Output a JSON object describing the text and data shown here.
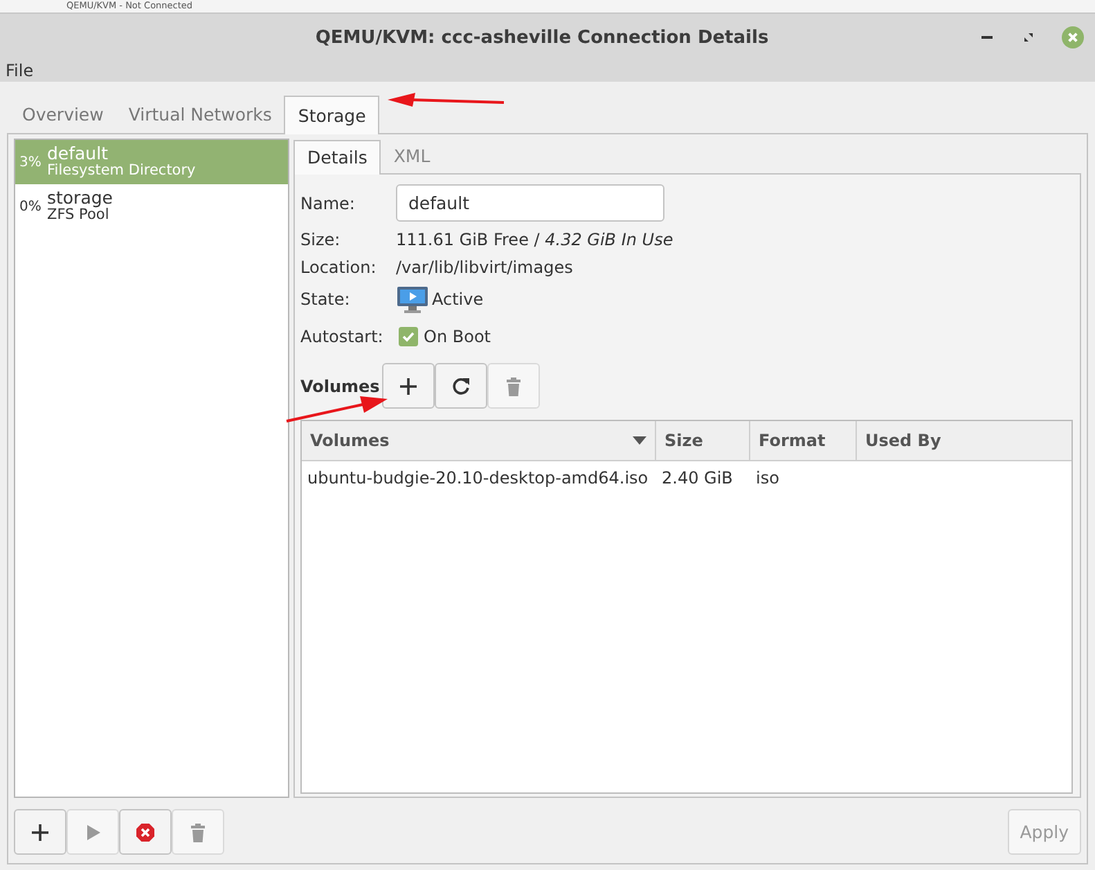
{
  "background_window": {
    "title": "QEMU/KVM - Not Connected"
  },
  "window": {
    "title": "QEMU/KVM: ccc-asheville Connection Details"
  },
  "menu": [
    "File"
  ],
  "tabs": [
    {
      "label": "Overview",
      "selected": false
    },
    {
      "label": "Virtual Networks",
      "selected": false
    },
    {
      "label": "Storage",
      "selected": true
    }
  ],
  "pools": [
    {
      "usage": "3%",
      "name": "default",
      "type": "Filesystem Directory",
      "selected": true
    },
    {
      "usage": "0%",
      "name": "storage",
      "type": "ZFS Pool",
      "selected": false
    }
  ],
  "detail_tabs": [
    {
      "label": "Details",
      "selected": true
    },
    {
      "label": "XML",
      "selected": false
    }
  ],
  "details": {
    "name_label": "Name:",
    "name": "default",
    "size_label": "Size:",
    "size": "111.61 GiB Free / *4.32 GiB In Use*",
    "location_label": "Location:",
    "location": "/var/lib/libvirt/images",
    "state_label": "State:",
    "state": "Active",
    "autostart_label": "Autostart:",
    "autostart": "On Boot",
    "autostart_checked": true
  },
  "volumes": {
    "label": "Volumes",
    "buttons": [
      {
        "kind": "add",
        "disabled": false
      },
      {
        "kind": "refresh",
        "disabled": false
      },
      {
        "kind": "delete",
        "disabled": true
      }
    ],
    "columns": [
      {
        "label": "Volumes",
        "sorted": true
      },
      {
        "label": "Size",
        "sorted": false
      },
      {
        "label": "Format",
        "sorted": false
      },
      {
        "label": "Used By",
        "sorted": false
      }
    ],
    "rows": [
      {
        "name": "ubuntu-budgie-20.10-desktop-amd64.iso",
        "size": "2.40 GiB",
        "format": "iso"
      }
    ]
  },
  "pool_buttons": [
    {
      "kind": "add",
      "disabled": false
    },
    {
      "kind": "start",
      "disabled": true
    },
    {
      "kind": "stop",
      "disabled": false
    },
    {
      "kind": "delete",
      "disabled": true
    }
  ],
  "apply": {
    "label": "Apply",
    "disabled": true
  }
}
